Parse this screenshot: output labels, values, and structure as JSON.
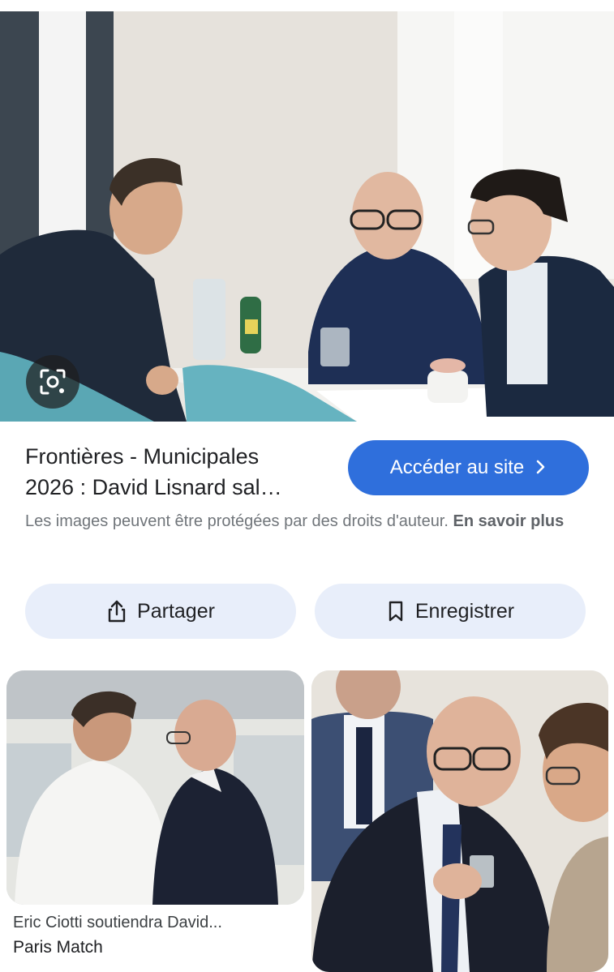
{
  "result": {
    "title_line1": "Frontières - Municipales",
    "title_line2": "2026 : David Lisnard sal…",
    "visit_button_label": "Accéder au site",
    "copyright_text": "Les images peuvent être protégées par des droits d'auteur.",
    "learn_more_link": "En savoir plus"
  },
  "actions": {
    "share_label": "Partager",
    "save_label": "Enregistrer"
  },
  "related": [
    {
      "title": "Eric Ciotti soutiendra David...",
      "source": "Paris Match"
    }
  ],
  "icons": {
    "lens": "lens-icon",
    "visit_chevron": "chevron-right-icon",
    "share": "share-icon",
    "save": "bookmark-icon"
  },
  "colors": {
    "accent": "#2f6fdc",
    "pill_background": "#e8eefa",
    "text_primary": "#202124",
    "text_secondary": "#70757a"
  }
}
